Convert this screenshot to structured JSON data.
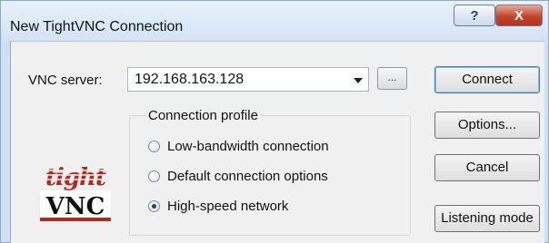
{
  "window": {
    "title": "New TightVNC Connection",
    "help_glyph": "?",
    "close_glyph": "X"
  },
  "server": {
    "label": "VNC server:",
    "value": "192.168.163.128",
    "browse_label": "..."
  },
  "logo": {
    "top_text": "tight",
    "bottom_text": "VNC",
    "colors": {
      "brand_red": "#b02a1e"
    }
  },
  "profile": {
    "title": "Connection profile",
    "options": [
      {
        "label": "Low-bandwidth connection",
        "selected": false
      },
      {
        "label": "Default connection options",
        "selected": false
      },
      {
        "label": "High-speed network",
        "selected": true
      }
    ]
  },
  "buttons": {
    "connect": "Connect",
    "options": "Options...",
    "cancel": "Cancel",
    "listening": "Listening mode"
  }
}
